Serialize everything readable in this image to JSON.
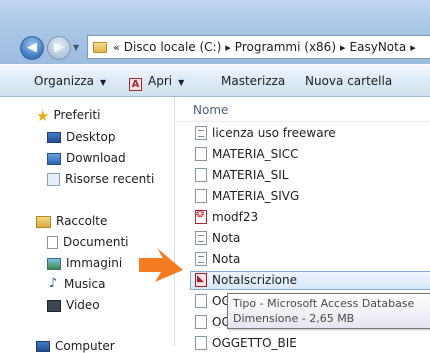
{
  "address_bar": {
    "crumbs": [
      "Disco locale (C:)",
      "Programmi (x86)",
      "EasyNota"
    ],
    "overflow": "«"
  },
  "nav_buttons": {
    "back": "◀",
    "forward": "▶",
    "recent_dropdown": "▼"
  },
  "toolbar": {
    "organizza": "Organizza",
    "apri": "Apri",
    "apri_icon_letter": "A",
    "masterizza": "Masterizza",
    "nuova_cartella": "Nuova cartella",
    "dropdown_arrow": "▼"
  },
  "nav_pane": {
    "favorites_label": "Preferiti",
    "favorites": [
      "Desktop",
      "Download",
      "Risorse recenti"
    ],
    "libraries_label": "Raccolte",
    "libraries": [
      "Documenti",
      "Immagini",
      "Musica",
      "Video"
    ],
    "computer_label": "Computer"
  },
  "file_list": {
    "column_header": "Nome",
    "files": [
      {
        "name": "licenza uso freeware",
        "icon": "text-file-icon"
      },
      {
        "name": "MATERIA_SICC",
        "icon": "file-icon"
      },
      {
        "name": "MATERIA_SIL",
        "icon": "file-icon"
      },
      {
        "name": "MATERIA_SIVG",
        "icon": "file-icon"
      },
      {
        "name": "modf23",
        "icon": "pdf-file-icon"
      },
      {
        "name": "Nota",
        "icon": "text-file-icon"
      },
      {
        "name": "Nota",
        "icon": "text-file-icon"
      },
      {
        "name": "NotaIscrizione",
        "icon": "access-database-icon",
        "selected": true
      },
      {
        "name": "OGGETTO_BIE",
        "icon": "file-icon"
      },
      {
        "name": "OGGETTO_BIE",
        "icon": "file-icon"
      },
      {
        "name": "OGGETTO_BIE",
        "icon": "file-icon"
      }
    ]
  },
  "tooltip": {
    "type_line": "Tipo - Microsoft Access Database",
    "size_line": "Dimensione - 2,65 MB"
  },
  "annotation": {
    "arrow_color": "#f47b20",
    "icon": "pointer-arrow-icon"
  },
  "colors": {
    "selection_border": "#84acdd",
    "accent": "#3c76c2"
  }
}
